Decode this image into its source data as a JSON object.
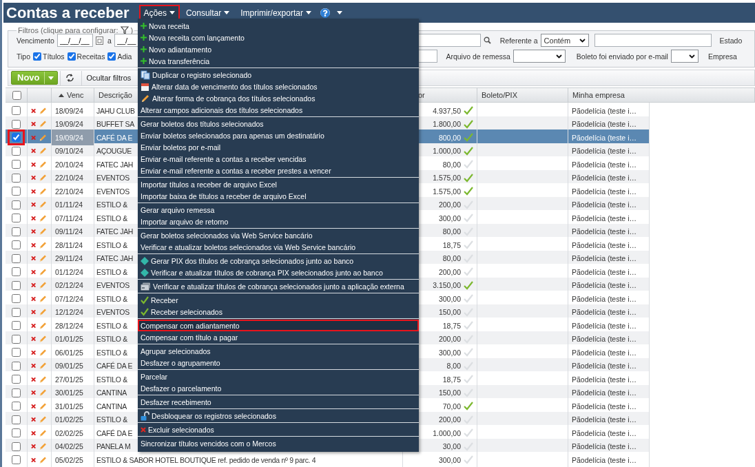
{
  "header": {
    "title": "Contas a receber",
    "menu": [
      {
        "label": "Ações",
        "highlighted": true
      },
      {
        "label": "Consultar",
        "highlighted": false
      },
      {
        "label": "Imprimir/exportar",
        "highlighted": false
      }
    ]
  },
  "filters": {
    "legend": "Filtros (clique para configurar:",
    "legend_end": ")",
    "due_label": "Vencimento",
    "due_from": "__/__/__",
    "due_sep": "a",
    "due_to": "__/__",
    "referente_label": "Referente a",
    "referente_match": "Contém",
    "estado_label": "Estado",
    "tipo_label": "Tipo",
    "tipos": [
      {
        "label": "Títulos",
        "checked": true
      },
      {
        "label": "Receitas",
        "checked": true
      },
      {
        "label": "Adia",
        "checked": true
      }
    ],
    "remessa_label": "Arquivo de remessa",
    "email_label": "Boleto foi enviado por e-mail",
    "empresa_label": "Empresa"
  },
  "toolbar": {
    "new_label": "Novo",
    "hide_filters": "Ocultar filtros"
  },
  "table": {
    "all_selected": false,
    "columns": [
      {
        "label": "Venc",
        "sorted": true
      },
      {
        "label": "Descrição",
        "sorted": false
      },
      {
        "label": "or",
        "sorted": false
      },
      {
        "label": "Boleto/PIX",
        "sorted": false
      },
      {
        "label": "Minha empresa",
        "sorted": false
      }
    ],
    "rows": [
      {
        "venc": "18/09/24",
        "description": "JAHU CLUB",
        "value": "4.937,50",
        "received": true,
        "company": "Pãodelícia (teste i…",
        "selected": false,
        "highlighted": false
      },
      {
        "venc": "19/09/24",
        "description": "BUFFET SA",
        "value": "1.800,00",
        "received": true,
        "company": "Pãodelícia (teste i…",
        "selected": false,
        "highlighted": false
      },
      {
        "venc": "19/09/24",
        "description": "CAFÉ DA E",
        "value": "800,00",
        "received": true,
        "company": "Pãodelícia (teste i…",
        "selected": true,
        "highlighted": true
      },
      {
        "venc": "09/10/24",
        "description": "AÇOUGUE",
        "value": "1.000,00",
        "received": true,
        "company": "Pãodelícia (teste i…",
        "selected": false,
        "highlighted": false
      },
      {
        "venc": "20/10/24",
        "description": "FATEC JAH",
        "value": "80,00",
        "received": false,
        "company": "Pãodelícia (teste i…",
        "selected": false,
        "highlighted": false
      },
      {
        "venc": "22/10/24",
        "description": "EVENTOS",
        "value": "1.575,00",
        "received": true,
        "company": "Pãodelícia (teste i…",
        "selected": false,
        "highlighted": false
      },
      {
        "venc": "22/10/24",
        "description": "EVENTOS",
        "value": "1.575,00",
        "received": true,
        "company": "Pãodelícia (teste i…",
        "selected": false,
        "highlighted": false
      },
      {
        "venc": "01/11/24",
        "description": "ESTILO &",
        "value": "200,00",
        "received": false,
        "company": "Pãodelícia (teste i…",
        "selected": false,
        "highlighted": false
      },
      {
        "venc": "07/11/24",
        "description": "ESTILO &",
        "value": "300,00",
        "received": false,
        "company": "Pãodelícia (teste i…",
        "selected": false,
        "highlighted": false
      },
      {
        "venc": "09/11/24",
        "description": "FATEC JAH",
        "value": "80,00",
        "received": false,
        "company": "Pãodelícia (teste i…",
        "selected": false,
        "highlighted": false
      },
      {
        "venc": "28/11/24",
        "description": "ESTILO &",
        "value": "18,75",
        "received": false,
        "company": "Pãodelícia (teste i…",
        "selected": false,
        "highlighted": false
      },
      {
        "venc": "29/11/24",
        "description": "FATEC JAH",
        "value": "80,00",
        "received": false,
        "company": "Pãodelícia (teste i…",
        "selected": false,
        "highlighted": false
      },
      {
        "venc": "01/12/24",
        "description": "ESTILO &",
        "value": "200,00",
        "received": false,
        "company": "Pãodelícia (teste i…",
        "selected": false,
        "highlighted": false
      },
      {
        "venc": "02/12/24",
        "description": "EVENTOS",
        "value": "3.150,00",
        "received": true,
        "company": "Pãodelícia (teste i…",
        "selected": false,
        "highlighted": false
      },
      {
        "venc": "07/12/24",
        "description": "ESTILO &",
        "value": "300,00",
        "received": false,
        "company": "Pãodelícia (teste i…",
        "selected": false,
        "highlighted": false
      },
      {
        "venc": "12/12/24",
        "description": "EVENTOS",
        "value": "150,00",
        "received": false,
        "company": "Pãodelícia (teste i…",
        "selected": false,
        "highlighted": false
      },
      {
        "venc": "28/12/24",
        "description": "ESTILO &",
        "value": "18,75",
        "received": false,
        "company": "Pãodelícia (teste i…",
        "selected": false,
        "highlighted": false
      },
      {
        "venc": "01/01/25",
        "description": "ESTILO &",
        "value": "200,00",
        "received": false,
        "company": "Pãodelícia (teste i…",
        "selected": false,
        "highlighted": false
      },
      {
        "venc": "06/01/25",
        "description": "ESTILO &",
        "value": "300,00",
        "received": false,
        "company": "Pãodelícia (teste i…",
        "selected": false,
        "highlighted": false
      },
      {
        "venc": "09/01/25",
        "description": "CAFÉ DA E",
        "value": "8,00",
        "received": false,
        "company": "Pãodelícia (teste i…",
        "selected": false,
        "highlighted": false
      },
      {
        "venc": "27/01/25",
        "description": "ESTILO &",
        "value": "18,75",
        "received": false,
        "company": "Pãodelícia (teste i…",
        "selected": false,
        "highlighted": false
      },
      {
        "venc": "30/01/25",
        "description": "CANTINA",
        "value": "150,00",
        "received": false,
        "company": "Pãodelícia (teste i…",
        "selected": false,
        "highlighted": false
      },
      {
        "venc": "31/01/25",
        "description": "CANTINA",
        "value": "70,00",
        "received": true,
        "company": "Pãodelícia (teste i…",
        "selected": false,
        "highlighted": false
      },
      {
        "venc": "01/02/25",
        "description": "ESTILO &",
        "value": "200,00",
        "received": false,
        "company": "Pãodelícia (teste i…",
        "selected": false,
        "highlighted": false
      },
      {
        "venc": "02/02/25",
        "description": "CAFÉ DA E",
        "value": "1.000,00",
        "received": false,
        "company": "Pãodelícia (teste i…",
        "selected": false,
        "highlighted": false
      },
      {
        "venc": "04/02/25",
        "description": "PANELA M",
        "value": "30,00",
        "received": false,
        "company": "Pãodelícia (teste i…",
        "selected": false,
        "highlighted": false
      },
      {
        "venc": "05/02/25",
        "description": "ESTILO & SABOR HOTEL BOUTIQUE ref. pedido de venda nº 9 parc. 4",
        "value": "300,00",
        "received": false,
        "company": "Pãodelícia (teste i…",
        "selected": false,
        "highlighted": false
      }
    ]
  },
  "actions_menu": {
    "groups": [
      {
        "items": [
          {
            "label": "Nova receita",
            "kind": "plus",
            "highlighted": false
          },
          {
            "label": "Nova receita com lançamento",
            "kind": "plus",
            "highlighted": false
          },
          {
            "label": "Novo adiantamento",
            "kind": "plus",
            "highlighted": false
          },
          {
            "label": "Nova transferência",
            "kind": "plus",
            "highlighted": false
          }
        ]
      },
      {
        "items": [
          {
            "label": "Duplicar o registro selecionado",
            "kind": "copy",
            "highlighted": false
          },
          {
            "label": "Alterar data de vencimento dos títulos selecionados",
            "kind": "calendar",
            "highlighted": false
          },
          {
            "label": "Alterar forma de cobrança dos títulos selecionados",
            "kind": "pencil",
            "highlighted": false
          },
          {
            "label": "Alterar campos adicionais dos títulos selecionados",
            "kind": "text",
            "highlighted": false
          }
        ]
      },
      {
        "items": [
          {
            "label": "Gerar boletos dos títulos selecionados",
            "kind": "text",
            "highlighted": false
          },
          {
            "label": "Enviar boletos selecionados para apenas um destinatário",
            "kind": "text",
            "highlighted": false
          },
          {
            "label": "Enviar boletos por e-mail",
            "kind": "text",
            "highlighted": false
          },
          {
            "label": "Enviar e-mail referente a contas a receber vencidas",
            "kind": "text",
            "highlighted": false
          },
          {
            "label": "Enviar e-mail referente a contas a receber prestes a vencer",
            "kind": "text",
            "highlighted": false
          }
        ]
      },
      {
        "items": [
          {
            "label": "Importar títulos a receber de arquivo Excel",
            "kind": "text",
            "highlighted": false
          },
          {
            "label": "Importar baixa de títulos a receber de arquivo Excel",
            "kind": "text",
            "highlighted": false
          }
        ]
      },
      {
        "items": [
          {
            "label": "Gerar arquivo remessa",
            "kind": "text",
            "highlighted": false
          },
          {
            "label": "Importar arquivo de retorno",
            "kind": "text",
            "highlighted": false
          }
        ]
      },
      {
        "items": [
          {
            "label": "Gerar boletos selecionados via Web Service bancário",
            "kind": "text",
            "highlighted": false
          },
          {
            "label": "Verificar e atualizar boletos selecionados via Web Service bancário",
            "kind": "text",
            "highlighted": false
          }
        ]
      },
      {
        "items": [
          {
            "label": "Gerar PIX dos títulos de cobrança selecionados junto ao banco",
            "kind": "diamond",
            "highlighted": false
          },
          {
            "label": "Verificar e atualizar títulos de cobrança PIX selecionados junto ao banco",
            "kind": "diamond",
            "highlighted": false
          }
        ]
      },
      {
        "items": [
          {
            "label": "Verificar e atualizar títulos de cobrança selecionados junto a aplicação externa",
            "kind": "card",
            "highlighted": false
          }
        ]
      },
      {
        "items": [
          {
            "label": "Receber",
            "kind": "check",
            "highlighted": false
          },
          {
            "label": "Receber selecionados",
            "kind": "check",
            "highlighted": false
          }
        ]
      },
      {
        "items": [
          {
            "label": "Compensar com adiantamento",
            "kind": "text",
            "highlighted": true
          },
          {
            "label": "Compensar com título a pagar",
            "kind": "text",
            "highlighted": false
          }
        ]
      },
      {
        "items": [
          {
            "label": "Agrupar selecionados",
            "kind": "text",
            "highlighted": false
          },
          {
            "label": "Desfazer o agrupamento",
            "kind": "text",
            "highlighted": false
          }
        ]
      },
      {
        "items": [
          {
            "label": "Parcelar",
            "kind": "text",
            "highlighted": false
          },
          {
            "label": "Desfazer o parcelamento",
            "kind": "text",
            "highlighted": false
          }
        ]
      },
      {
        "items": [
          {
            "label": "Desfazer recebimento",
            "kind": "text",
            "highlighted": false
          }
        ]
      },
      {
        "items": [
          {
            "label": "Desbloquear os registros selecionados",
            "kind": "lock",
            "highlighted": false
          }
        ]
      },
      {
        "items": [
          {
            "label": "Excluir selecionados",
            "kind": "delete",
            "highlighted": false
          }
        ]
      },
      {
        "items": [
          {
            "label": "Sincronizar títulos vencidos com o Mercos",
            "kind": "text",
            "highlighted": false
          }
        ]
      }
    ]
  }
}
